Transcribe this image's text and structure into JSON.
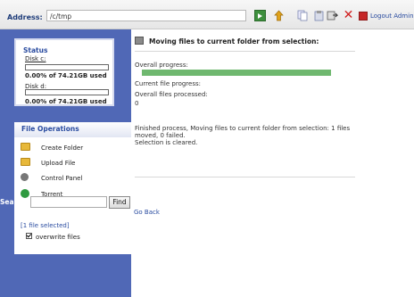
{
  "toolbar": {
    "address_label": "Address:",
    "address_value": "/c/tmp",
    "logout_label": "Logout Admin",
    "icons": [
      "go-icon",
      "upload-icon",
      "copy-icon",
      "paste-icon",
      "move-icon",
      "delete-icon",
      "logout-icon"
    ]
  },
  "status": {
    "title": "Status",
    "disks": [
      {
        "label": "Disk c:",
        "usage": "0.00% of 74.21GB  used",
        "fill_fraction": 0
      },
      {
        "label": "Disk d:",
        "usage": "0.00% of 74.21GB  used",
        "fill_fraction": 0
      }
    ]
  },
  "file_operations": {
    "title": "File Operations",
    "items": [
      {
        "label": "Create Folder",
        "icon": "folder-icon"
      },
      {
        "label": "Upload File",
        "icon": "upload-folder-icon"
      },
      {
        "label": "Control Panel",
        "icon": "gear-icon"
      },
      {
        "label": "Torrent",
        "icon": "torrent-icon"
      }
    ]
  },
  "search": {
    "label": "Search:",
    "value": "",
    "button_label": "Find"
  },
  "selection": {
    "count_label": "[1 file selected]",
    "overwrite_label": "overwrite files",
    "overwrite_checked": true
  },
  "main": {
    "title": "Moving files to current folder from selection:",
    "overall_progress_label": "Overall progress:",
    "overall_progress_fraction": 1.0,
    "current_progress_label": "Current file progress:",
    "files_processed_label": "Overall files processed:",
    "files_processed_value": "0",
    "message_line1": "Finished process, Moving files to current folder from selection: 1 files",
    "message_line2": "moved, 0 failed.",
    "message_line3": "Selection is cleared.",
    "go_back_label": "Go Back"
  },
  "colors": {
    "sidebar": "#5068b6",
    "accent_text": "#2a4ca0",
    "progress": "#6fb86f"
  }
}
